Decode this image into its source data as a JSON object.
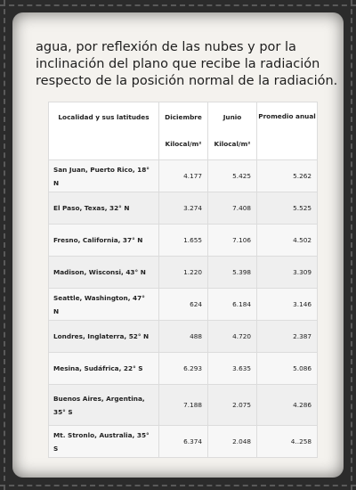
{
  "paragraph": "agua, por reflexión de las nubes y por la inclinación del plano que recibe la radiación respecto de la posición normal de la radiación.",
  "table": {
    "headers": {
      "location": "Localidad y sus latitudes",
      "december": "Diciembre",
      "december_unit": "Kilocal/m²",
      "june": "Junio",
      "june_unit": "Kilocal/m²",
      "annual": "Promedio anual"
    },
    "rows": [
      {
        "location": "San Juan, Puerto Rico, 18° N",
        "december": "4.177",
        "june": "5.425",
        "annual": "5.262"
      },
      {
        "location": "El Paso, Texas, 32° N",
        "december": "3.274",
        "june": "7.408",
        "annual": "5.525"
      },
      {
        "location": "Fresno, California, 37° N",
        "december": "1.655",
        "june": "7.106",
        "annual": "4.502"
      },
      {
        "location": "Madison, Wisconsi, 43° N",
        "december": "1.220",
        "june": "5.398",
        "annual": "3.309"
      },
      {
        "location": "Seattle, Washington, 47° N",
        "december": "624",
        "june": "6.184",
        "annual": "3.146"
      },
      {
        "location": "Londres, Inglaterra, 52° N",
        "december": "488",
        "june": "4.720",
        "annual": "2.387"
      },
      {
        "location": "Mesina, Sudáfrica, 22° S",
        "december": "6.293",
        "june": "3.635",
        "annual": "5.086"
      },
      {
        "location": "Buenos Aires, Argentina, 35° S",
        "december": "7.188",
        "june": "2.075",
        "annual": "4.286"
      },
      {
        "location": "Mt. Stronlo, Australia, 35° S",
        "december": "6.374",
        "june": "2.048",
        "annual": "4..258"
      }
    ]
  }
}
